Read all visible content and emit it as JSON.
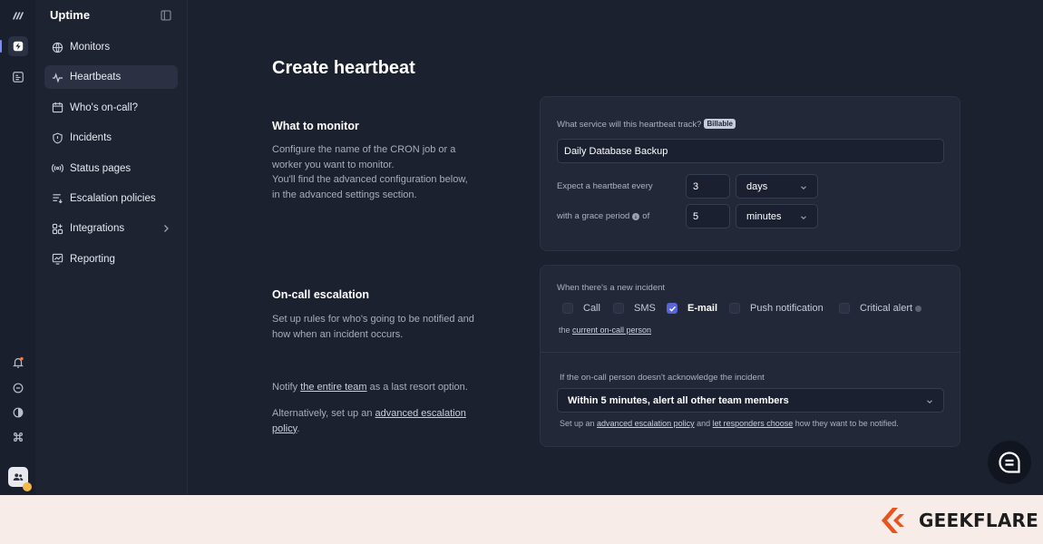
{
  "sidebar": {
    "brand": "Uptime",
    "items": [
      {
        "label": "Monitors",
        "icon": "globe-icon"
      },
      {
        "label": "Heartbeats",
        "icon": "heartbeat-icon",
        "active": true
      },
      {
        "label": "Who's on-call?",
        "icon": "calendar-icon"
      },
      {
        "label": "Incidents",
        "icon": "shield-icon"
      },
      {
        "label": "Status pages",
        "icon": "broadcast-icon"
      },
      {
        "label": "Escalation policies",
        "icon": "list-icon"
      },
      {
        "label": "Integrations",
        "icon": "puzzle-icon"
      },
      {
        "label": "Reporting",
        "icon": "chart-icon"
      }
    ]
  },
  "page": {
    "title": "Create heartbeat"
  },
  "what_to_monitor": {
    "title": "What to monitor",
    "description_lines": [
      "Configure the name of the CRON job or a",
      "worker you want to monitor.",
      "You'll find the advanced configuration below,",
      "in the advanced settings section."
    ],
    "service_label": "What service will this heartbeat track?",
    "badge": "Billable",
    "service_value": "Daily Database Backup",
    "expect_label": "Expect a heartbeat every",
    "expect_value": "3",
    "expect_unit": "days",
    "grace_label_a": "with a grace period",
    "grace_label_b": "of",
    "grace_value": "5",
    "grace_unit": "minutes"
  },
  "escalation": {
    "title": "On-call escalation",
    "description_lines": [
      "Set up rules for who's going to be notified and",
      "how when an incident occurs."
    ],
    "notify_pre": "Notify ",
    "notify_link": "the entire team",
    "notify_post": " as a last resort option.",
    "alt_pre": "Alternatively, set up an ",
    "alt_link_a": "advanced escalation",
    "alt_link_b": "policy",
    "alt_post": ".",
    "incident_label": "When there's a new incident",
    "channels": [
      {
        "label": "Call",
        "checked": false
      },
      {
        "label": "SMS",
        "checked": false
      },
      {
        "label": "E-mail",
        "checked": true
      },
      {
        "label": "Push notification",
        "checked": false
      },
      {
        "label": "Critical alert",
        "checked": false
      }
    ],
    "the_text": "the ",
    "oncall_link": "current on-call person",
    "ack_label": "If the on-call person doesn't acknowledge the incident",
    "ack_value": "Within 5 minutes, alert all other team members",
    "footer_a": "Set up an ",
    "footer_link1": "advanced escalation policy",
    "footer_b": " and ",
    "footer_link2": "let responders choose",
    "footer_c": " how they want to be notified."
  },
  "watermark": "GEEKFLARE",
  "colors": {
    "accent": "#5865d6",
    "background": "#1c2130",
    "card": "#222838",
    "footer": "#f8ece9",
    "brand_orange": "#e8541e"
  }
}
